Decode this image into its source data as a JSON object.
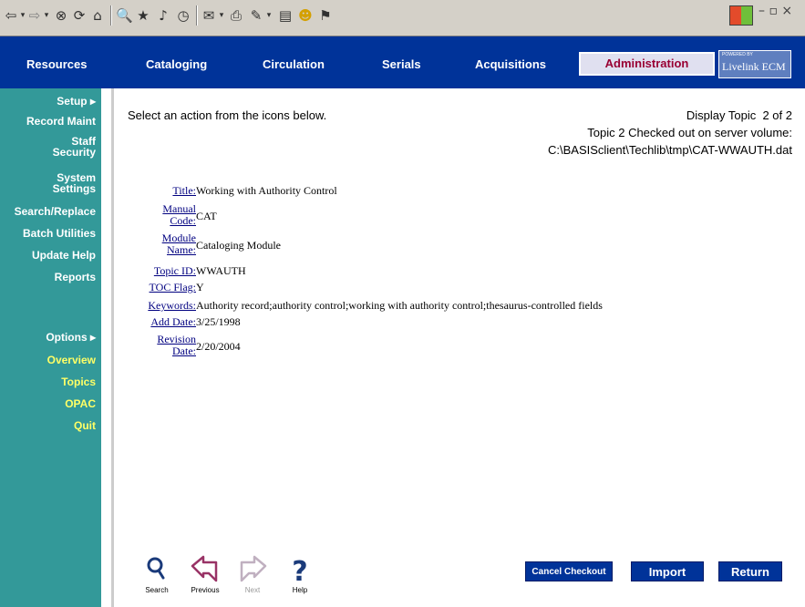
{
  "colors": {
    "nav_bg": "#003399",
    "sidebar_bg": "#339999",
    "admin_text": "#990033",
    "link": "#000080",
    "sidebar_highlight": "#ffff66"
  },
  "nav": {
    "items": [
      "Resources",
      "Cataloging",
      "Circulation",
      "Serials",
      "Acquisitions"
    ],
    "active": "Administration",
    "brand_small": "POWERED BY",
    "brand_big": "Livelink ECM"
  },
  "sidebar": {
    "setup": "Setup ▸",
    "items": [
      "Record Maint",
      "Staff Security",
      "System Settings",
      "Search/Replace",
      "Batch Utilities",
      "Update Help",
      "Reports"
    ],
    "options": "Options ▸",
    "option_items": [
      "Overview",
      "Topics",
      "OPAC",
      "Quit"
    ]
  },
  "main": {
    "instruction": "Select an action from the icons below.",
    "status_line1": "Display Topic  2 of 2",
    "status_line2": "Topic 2 Checked out on server volume:",
    "status_line3": "C:\\BASISclient\\Techlib\\tmp\\CAT-WWAUTH.dat"
  },
  "fields": [
    {
      "label": "Title:",
      "value": "Working with Authority Control"
    },
    {
      "label": "Manual Code:",
      "value": "CAT"
    },
    {
      "label": "Module Name:",
      "value": "Cataloging Module"
    },
    {
      "label": "Topic ID:",
      "value": "WWAUTH"
    },
    {
      "label": "TOC Flag:",
      "value": "Y"
    },
    {
      "label": "Keywords:",
      "value": "Authority record;authority control;working with authority control;thesaurus-controlled fields"
    },
    {
      "label": "Add Date:",
      "value": "3/25/1998"
    },
    {
      "label": "Revision Date:",
      "value": "2/20/2004"
    }
  ],
  "bottom_nav": {
    "search": "Search",
    "previous": "Previous",
    "next": "Next",
    "help": "Help"
  },
  "buttons": {
    "cancel_checkout": "Cancel Checkout",
    "import": "Import",
    "return": "Return"
  }
}
